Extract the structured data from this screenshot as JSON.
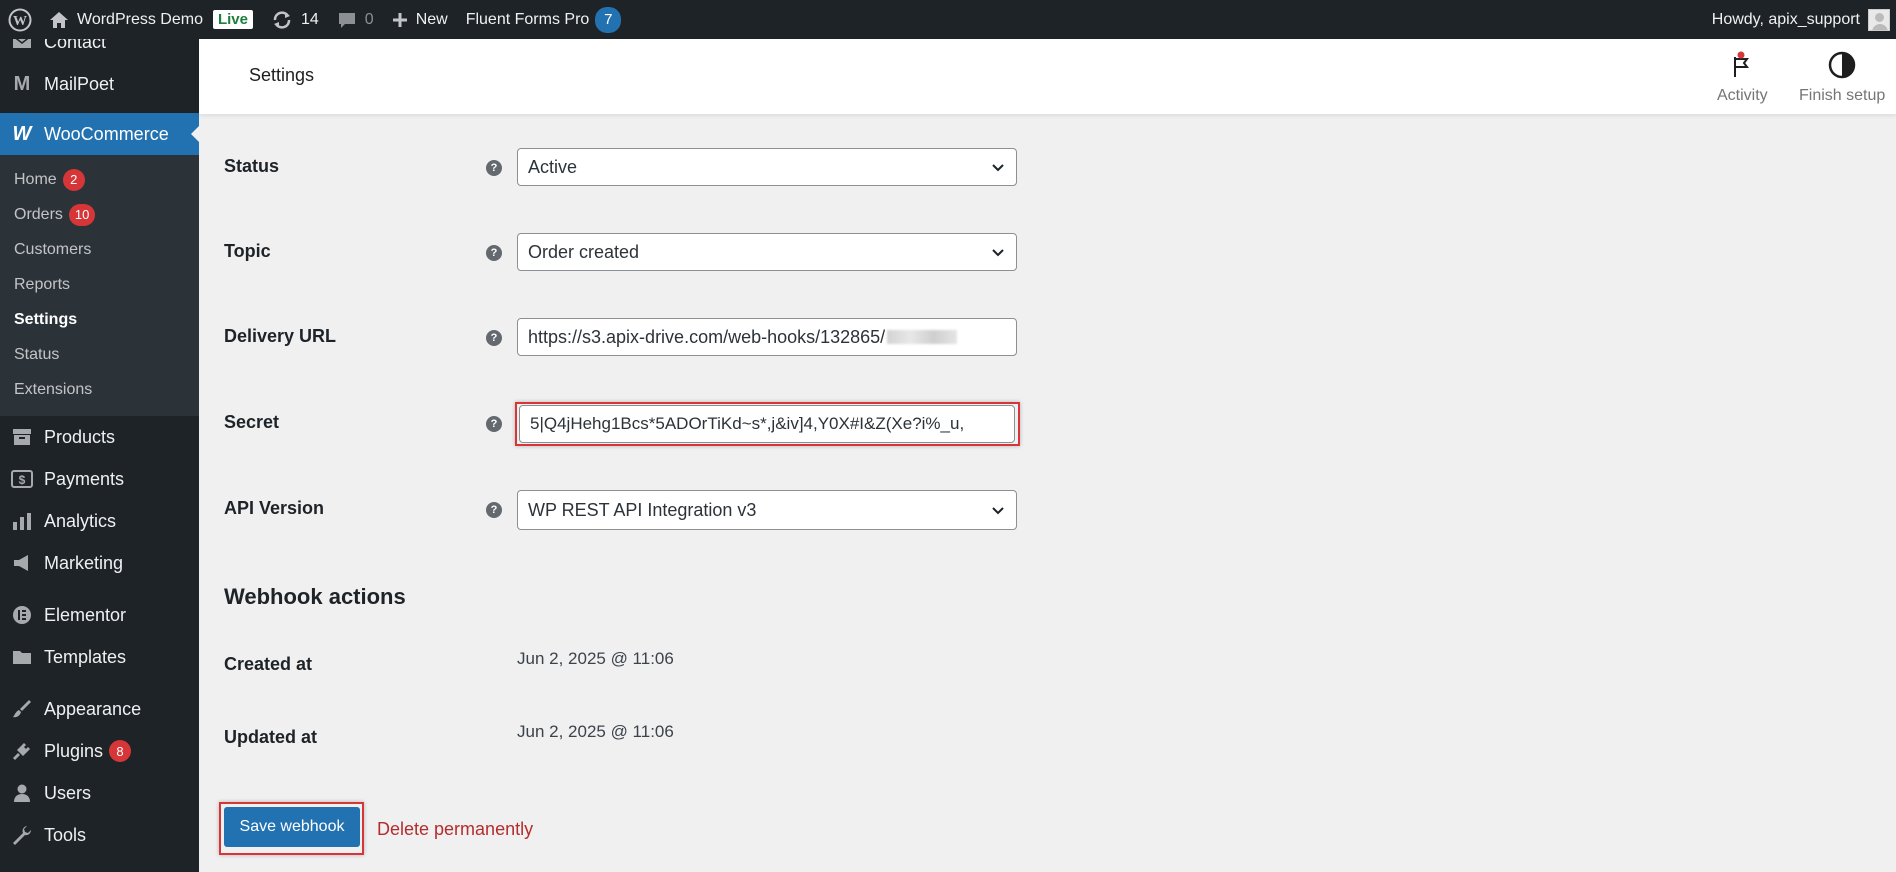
{
  "admin_bar": {
    "site_name": "WordPress Demo",
    "live_label": "Live",
    "updates_count": "14",
    "comments_count": "0",
    "new_label": "New",
    "plugin_name": "Fluent Forms Pro",
    "plugin_badge": "7",
    "howdy": "Howdy, apix_support"
  },
  "sidebar": {
    "contact": "Contact",
    "mailpoet": "MailPoet",
    "woocommerce": "WooCommerce",
    "submenu": {
      "home": "Home",
      "home_badge": "2",
      "orders": "Orders",
      "orders_badge": "10",
      "customers": "Customers",
      "reports": "Reports",
      "settings": "Settings",
      "status": "Status",
      "extensions": "Extensions"
    },
    "products": "Products",
    "payments": "Payments",
    "analytics": "Analytics",
    "marketing": "Marketing",
    "elementor": "Elementor",
    "templates": "Templates",
    "appearance": "Appearance",
    "plugins": "Plugins",
    "plugins_badge": "8",
    "users": "Users",
    "tools": "Tools"
  },
  "header": {
    "title": "Settings",
    "activity": "Activity",
    "finish_setup": "Finish setup"
  },
  "form": {
    "status_label": "Status",
    "status_value": "Active",
    "topic_label": "Topic",
    "topic_value": "Order created",
    "delivery_label": "Delivery URL",
    "delivery_value": "https://s3.apix-drive.com/web-hooks/132865/",
    "secret_label": "Secret",
    "secret_value": "5|Q4jHehg1Bcs*5ADOrTiKd~s*,j&iv]4,Y0X#I&Z(Xe?i%_u,",
    "api_label": "API Version",
    "api_value": "WP REST API Integration v3",
    "help_glyph": "?"
  },
  "actions": {
    "title": "Webhook actions",
    "created_label": "Created at",
    "created_value": "Jun 2, 2025 @ 11:06",
    "updated_label": "Updated at",
    "updated_value": "Jun 2, 2025 @ 11:06",
    "save_label": "Save webhook",
    "delete_label": "Delete permanently"
  },
  "colors": {
    "admin_bar": "#1d2327",
    "accent": "#2271b1",
    "danger": "#d63638",
    "delete_link": "#b32d2e"
  }
}
